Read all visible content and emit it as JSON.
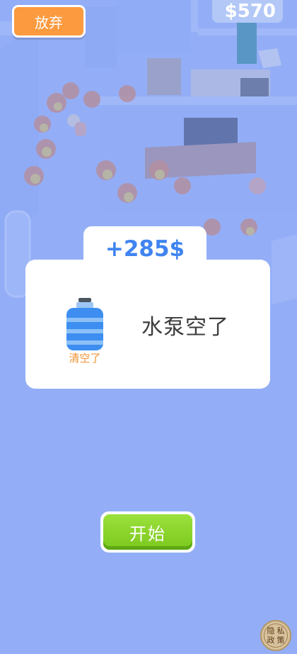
{
  "header": {
    "quit_label": "放弃",
    "money": "$570"
  },
  "reward": {
    "amount": "+285$"
  },
  "dialog": {
    "item_icon": "water-bottle-icon",
    "item_status": "清空了",
    "message": "水泵空了"
  },
  "start_label": "开始",
  "privacy": {
    "chars": [
      "隐",
      "私",
      "政",
      "策"
    ]
  },
  "colors": {
    "quit_button": "#fb9a3f",
    "reward_text": "#3f84f0",
    "start_button": "#8bd62a",
    "status_text": "#f09232",
    "background": "#8aa8f5"
  }
}
